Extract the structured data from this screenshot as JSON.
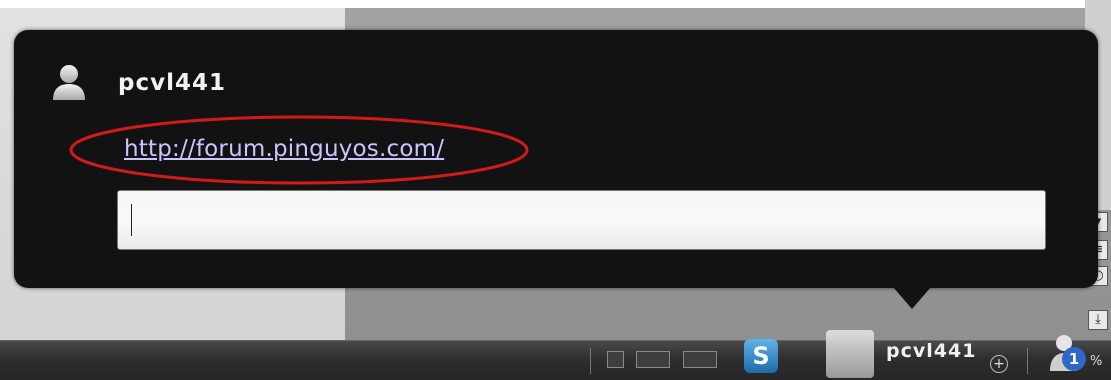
{
  "popup": {
    "username": "pcvl441",
    "link_text": "http://forum.pinguyos.com/",
    "input_value": ""
  },
  "taskbar": {
    "user_name": "pcvl441",
    "badge_count": "1",
    "percent_glyph": "%",
    "app_icon_glyph": "S",
    "plus_glyph": "+"
  },
  "side_buttons": {
    "down_glyph": "▾",
    "menu_glyph": "≡",
    "circle_glyph": "○",
    "bottom_glyph": "⤓"
  },
  "colors": {
    "popup_bg": "#121212",
    "link": "#c9c6ff",
    "highlight": "#d11a1a"
  }
}
